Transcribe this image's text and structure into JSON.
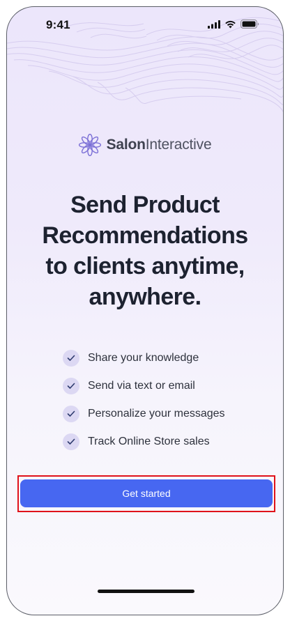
{
  "status_bar": {
    "time": "9:41",
    "icons": [
      "signal-icon",
      "wifi-icon",
      "battery-icon"
    ]
  },
  "brand": {
    "name_part1": "Salon",
    "name_part2": "Interactive",
    "logo_icon": "asterisk-flower-logo-icon",
    "logo_color": "#7b6fd6"
  },
  "headline": {
    "lines": [
      "Send Product",
      "Recommendations",
      "to clients anytime,",
      "anywhere."
    ]
  },
  "features": [
    {
      "label": "Share your knowledge"
    },
    {
      "label": "Send via text or email"
    },
    {
      "label": "Personalize your messages"
    },
    {
      "label": "Track Online Store sales"
    }
  ],
  "cta": {
    "label": "Get started",
    "color": "#4767f1"
  },
  "colors": {
    "background_top": "#ece6fb",
    "check_bg": "#dcd8f3",
    "check_mark": "#2d3a6e",
    "highlight": "#e0121a"
  }
}
